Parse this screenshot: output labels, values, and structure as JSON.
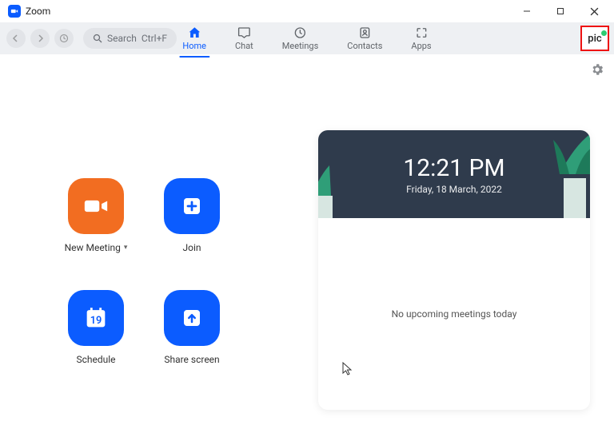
{
  "window": {
    "title": "Zoom"
  },
  "search": {
    "label": "Search",
    "shortcut": "Ctrl+F"
  },
  "tabs": {
    "home": "Home",
    "chat": "Chat",
    "meetings": "Meetings",
    "contacts": "Contacts",
    "apps": "Apps"
  },
  "profile": {
    "label": "pic"
  },
  "actions": {
    "new_meeting": "New Meeting",
    "join": "Join",
    "schedule": "Schedule",
    "share_screen": "Share screen",
    "schedule_day": "19"
  },
  "card": {
    "time": "12:21 PM",
    "date": "Friday, 18 March, 2022",
    "body": "No upcoming meetings today"
  }
}
